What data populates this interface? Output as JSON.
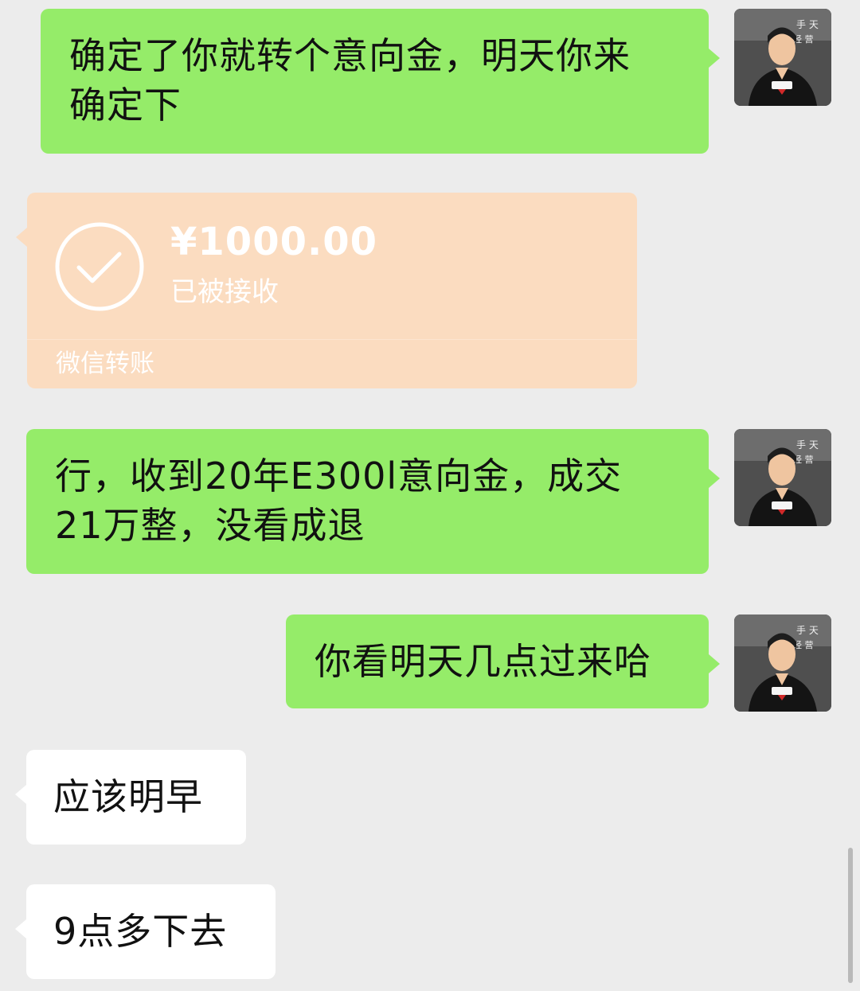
{
  "messages": [
    {
      "direction": "out",
      "lines": [
        "确定了你就转个意向金，明天你来",
        "确定下"
      ]
    },
    {
      "direction": "in",
      "type": "transfer",
      "amount": "¥1000.00",
      "status": "已被接收",
      "label": "微信转账"
    },
    {
      "direction": "out",
      "lines": [
        "行，收到20年E300l意向金，成交",
        "21万整，没看成退"
      ]
    },
    {
      "direction": "out",
      "lines": [
        "你看明天几点过来哈"
      ]
    },
    {
      "direction": "in",
      "lines": [
        "应该明早"
      ]
    },
    {
      "direction": "in",
      "lines": [
        "9点多下去"
      ]
    }
  ],
  "watermark": "",
  "colors": {
    "background": "#ececec",
    "outgoing_bubble": "#95ec69",
    "incoming_bubble": "#ffffff",
    "transfer_card": "#fbdcc0"
  },
  "icons": {
    "avatar": "avatar-image",
    "transfer": "check-circle-icon"
  }
}
